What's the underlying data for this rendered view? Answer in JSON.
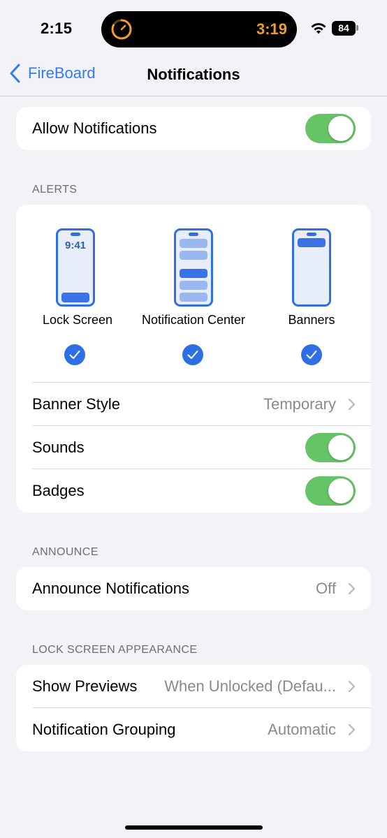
{
  "status_bar": {
    "time": "2:15",
    "island_time": "3:19",
    "battery": "84"
  },
  "nav": {
    "back_label": "FireBoard",
    "title": "Notifications"
  },
  "allow_notifications": {
    "label": "Allow Notifications",
    "enabled": true
  },
  "alerts": {
    "header": "ALERTS",
    "options": [
      {
        "label": "Lock Screen",
        "clock": "9:41",
        "checked": true
      },
      {
        "label": "Notification Center",
        "checked": true
      },
      {
        "label": "Banners",
        "checked": true
      }
    ],
    "banner_style": {
      "label": "Banner Style",
      "value": "Temporary"
    },
    "sounds": {
      "label": "Sounds",
      "enabled": true
    },
    "badges": {
      "label": "Badges",
      "enabled": true
    }
  },
  "announce": {
    "header": "ANNOUNCE",
    "announce_notifications": {
      "label": "Announce Notifications",
      "value": "Off"
    }
  },
  "lock_screen_appearance": {
    "header": "LOCK SCREEN APPEARANCE",
    "show_previews": {
      "label": "Show Previews",
      "value": "When Unlocked (Defau..."
    },
    "notification_grouping": {
      "label": "Notification Grouping",
      "value": "Automatic"
    }
  },
  "colors": {
    "accent": "#2f7cf6",
    "toggle_on": "#65c466",
    "background": "#f2f2f7",
    "dynamic_island_time": "#ee9c2c"
  }
}
